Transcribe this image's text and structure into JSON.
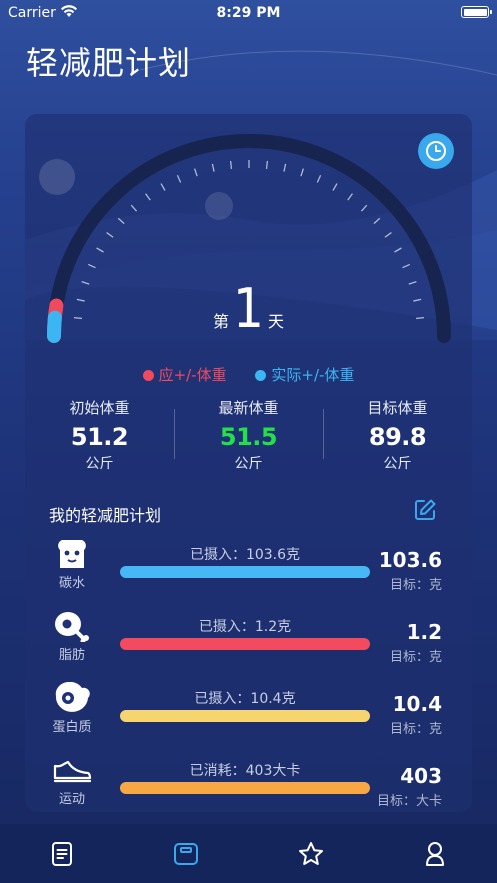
{
  "status": {
    "carrier": "Carrier",
    "time": "8:29 PM"
  },
  "page": {
    "title": "轻减肥计划"
  },
  "progress": {
    "day_prefix": "第",
    "day_number": "1",
    "day_suffix": "天",
    "expected_change_fraction": 0.05,
    "actual_change_fraction": 0.03
  },
  "legend": [
    {
      "label": "应+/-体重",
      "color": "#f04a5c"
    },
    {
      "label": "实际+/-体重",
      "color": "#3bb6f2"
    }
  ],
  "weights": [
    {
      "label": "初始体重",
      "value": "51.2",
      "unit": "公斤",
      "color": "#ffffff"
    },
    {
      "label": "最新体重",
      "value": "51.5",
      "unit": "公斤",
      "color": "#22e04a"
    },
    {
      "label": "目标体重",
      "value": "89.8",
      "unit": "公斤",
      "color": "#ffffff"
    }
  ],
  "plan": {
    "title": "我的轻减肥计划",
    "items": [
      {
        "icon": "bread-icon",
        "name": "碳水",
        "intake": "已摄入：103.6克",
        "amount": "103.6",
        "target": "目标：克",
        "bar_color": "#47b8f5"
      },
      {
        "icon": "meat-icon",
        "name": "脂肪",
        "intake": "已摄入：1.2克",
        "amount": "1.2",
        "target": "目标：克",
        "bar_color": "#f24a5e"
      },
      {
        "icon": "steak-icon",
        "name": "蛋白质",
        "intake": "已摄入：10.4克",
        "amount": "10.4",
        "target": "目标：克",
        "bar_color": "#f7d56e"
      },
      {
        "icon": "shoe-icon",
        "name": "运动",
        "intake": "已消耗：403大卡",
        "amount": "403",
        "target": "目标：大卡",
        "bar_color": "#f8a745"
      }
    ]
  },
  "tabbar": [
    {
      "name": "records-tab",
      "icon": "list-icon",
      "active": false
    },
    {
      "name": "scale-tab",
      "icon": "scale-icon",
      "active": true
    },
    {
      "name": "favorites-tab",
      "icon": "star-icon",
      "active": false
    },
    {
      "name": "profile-tab",
      "icon": "person-icon",
      "active": false
    }
  ],
  "colors": {
    "accent": "#3aa8ec",
    "gauge_red": "#f04a5c",
    "gauge_blue": "#3bb6f2"
  }
}
